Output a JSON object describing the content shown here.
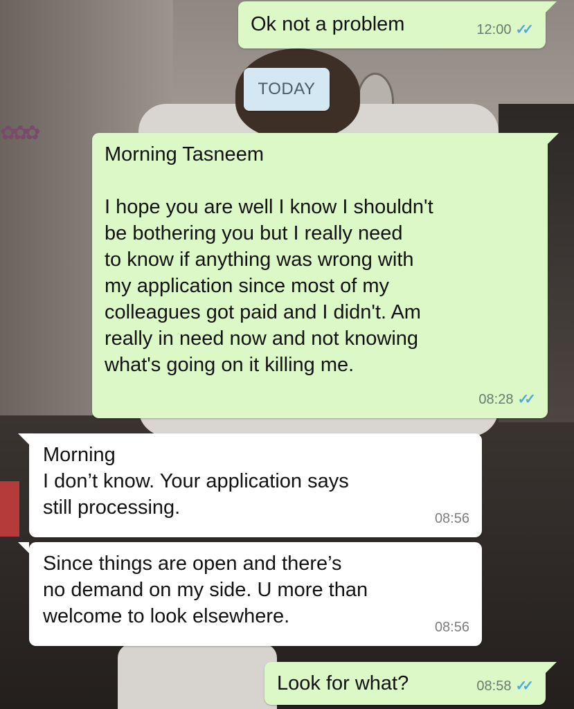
{
  "chat": {
    "date_divider": "TODAY",
    "messages": [
      {
        "direction": "outgoing",
        "text": "Ok not a problem",
        "time": "12:00",
        "status_icon": "double-check-read-icon"
      },
      {
        "direction": "outgoing",
        "text": "Morning Tasneem\n\nI hope you are well I know I shouldn't\nbe bothering you but I really need\nto know if anything was wrong with\nmy application since most of my\ncolleagues got paid and I didn't. Am\nreally in need now and not knowing\nwhat's going on it killing me.",
        "time": "08:28",
        "status_icon": "double-check-read-icon"
      },
      {
        "direction": "incoming",
        "text": "Morning\nI don’t know. Your application says\nstill processing.",
        "time": "08:56"
      },
      {
        "direction": "incoming",
        "text": "Since things are open and there’s\nno demand on my side. U more than\nwelcome to look elsewhere.",
        "time": "08:56"
      },
      {
        "direction": "outgoing",
        "text": "Look for what?",
        "time": "08:58",
        "status_icon": "double-check-read-icon"
      }
    ]
  },
  "colors": {
    "outgoing_bubble": "#dcf8c6",
    "incoming_bubble": "#ffffff",
    "date_chip": "#d3e8f3",
    "read_ticks": "#4fa8e0"
  }
}
